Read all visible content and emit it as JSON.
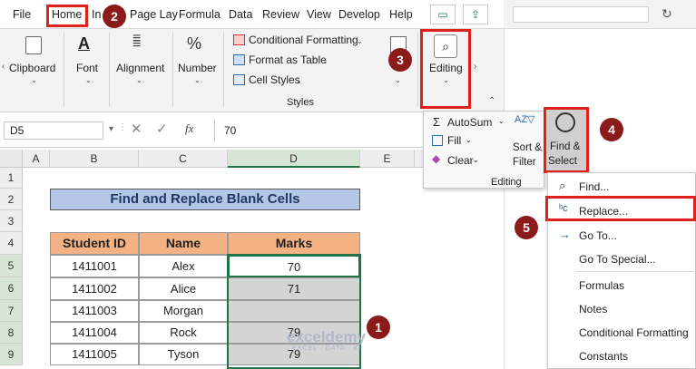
{
  "ribbon": {
    "tabs": [
      "File",
      "Home",
      "In",
      "Page Lay",
      "Formula",
      "Data",
      "Review",
      "View",
      "Develop",
      "Help"
    ],
    "groups": {
      "clipboard": "Clipboard",
      "font": "Font",
      "alignment": "Alignment",
      "number": "Number",
      "editing": "Editing",
      "styles_label": "Styles"
    },
    "styles_items": [
      "Conditional Formatting",
      "Format as Table",
      "Cell Styles"
    ],
    "number_symbol": "%"
  },
  "formula_bar": {
    "name_box": "D5",
    "fx": "fx",
    "value": "70"
  },
  "editing_popup": {
    "autosum": "AutoSum",
    "fill": "Fill",
    "clear": "Clear",
    "sort_filter": [
      "Sort &",
      "Filter"
    ],
    "find_select": [
      "Find &",
      "Select"
    ],
    "group_label": "Editing"
  },
  "find_menu": {
    "items": [
      "Find...",
      "Replace...",
      "Go To...",
      "Go To Special...",
      "Formulas",
      "Notes",
      "Conditional Formatting",
      "Constants"
    ]
  },
  "sheet": {
    "columns": [
      "A",
      "B",
      "C",
      "D",
      "E"
    ],
    "rows": [
      "1",
      "2",
      "3",
      "4",
      "5",
      "6",
      "7",
      "8",
      "9"
    ],
    "title": "Find and Replace Blank Cells",
    "headers": [
      "Student ID",
      "Name",
      "Marks"
    ],
    "data": [
      [
        "1411001",
        "Alex",
        "70"
      ],
      [
        "1411002",
        "Alice",
        "71"
      ],
      [
        "1411003",
        "Morgan",
        ""
      ],
      [
        "1411004",
        "Rock",
        "79"
      ],
      [
        "1411005",
        "Tyson",
        "79"
      ]
    ]
  },
  "steps": [
    "1",
    "2",
    "3",
    "4",
    "5"
  ],
  "watermark": {
    "name": "exceldemy",
    "tagline": "EXCEL · DATA · BI"
  },
  "colors": {
    "title_fill": "#b4c7e7",
    "header_fill": "#f4b183",
    "selected_fill": "#d4d4d4",
    "highlight": "#e0201b",
    "badge": "#8b1a1a",
    "excel_green": "#217346"
  }
}
